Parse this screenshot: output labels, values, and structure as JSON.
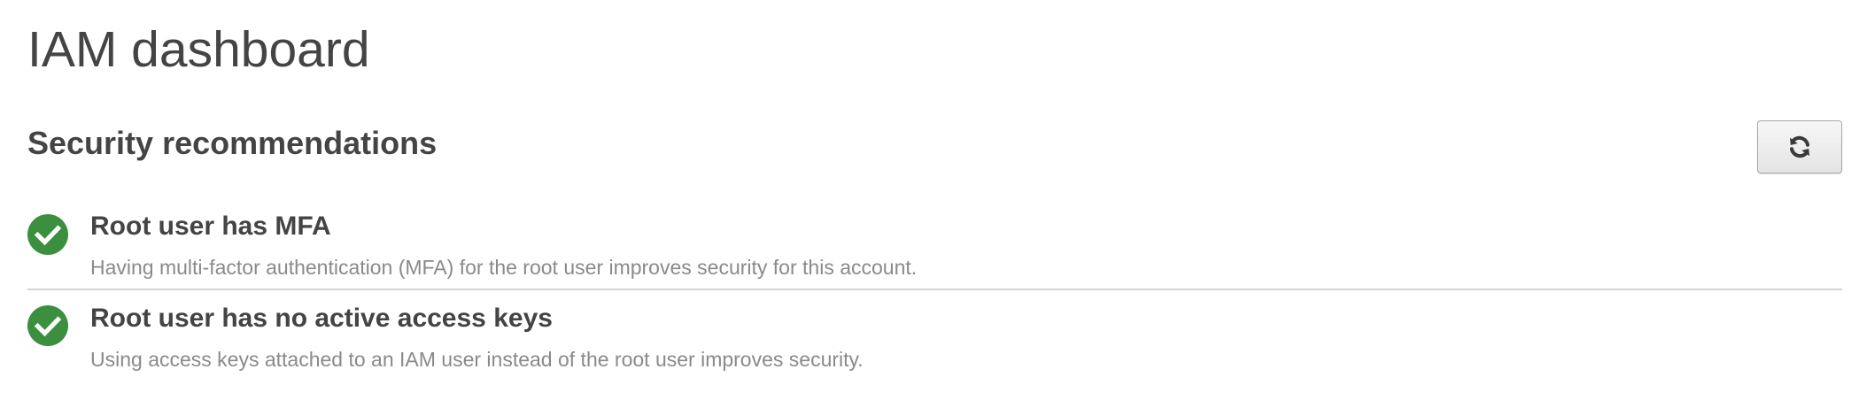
{
  "header": {
    "title": "IAM dashboard"
  },
  "security": {
    "title": "Security recommendations",
    "refresh_icon": "refresh-icon",
    "items": [
      {
        "status": "passed",
        "icon": "check-circle-icon",
        "title": "Root user has MFA",
        "description": "Having multi-factor authentication (MFA) for the root user improves security for this account."
      },
      {
        "status": "passed",
        "icon": "check-circle-icon",
        "title": "Root user has no active access keys",
        "description": "Using access keys attached to an IAM user instead of the root user improves security."
      }
    ]
  },
  "colors": {
    "success": "#3b8f3e",
    "text": "#444444",
    "muted_text": "#8a8a8a",
    "divider": "#d5d5d5"
  }
}
